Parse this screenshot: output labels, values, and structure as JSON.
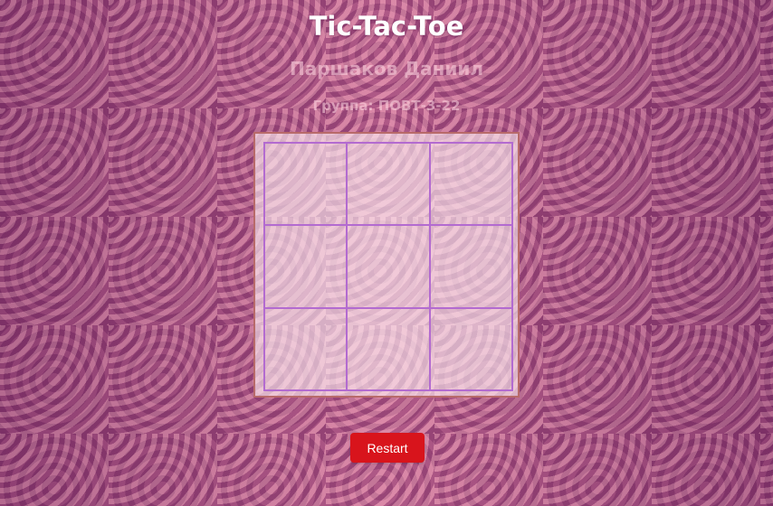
{
  "game": {
    "title": "Tic-Tac-Toe",
    "author": "Паршаков Даниил",
    "group": "Группа: ПОВТ-3-22"
  },
  "board": {
    "cells": [
      "",
      "",
      "",
      "",
      "",
      "",
      "",
      "",
      ""
    ]
  },
  "controls": {
    "restart_label": "Restart"
  },
  "colors": {
    "grid_line": "#b36bd0",
    "restart_bg": "#d8141c",
    "frame_border": "#b86a6a"
  }
}
